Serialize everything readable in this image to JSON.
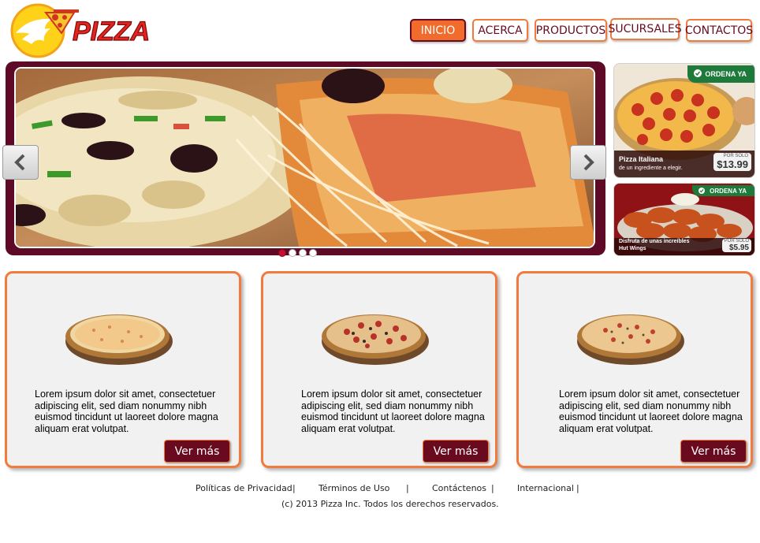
{
  "brand": {
    "logo_text": "PIZZA"
  },
  "nav": {
    "items": [
      {
        "label": "INICIO",
        "active": true
      },
      {
        "label": "ACERCA",
        "active": false
      },
      {
        "label": "PRODUCTOS",
        "active": false
      },
      {
        "label": "SUCURSALES",
        "active": false
      },
      {
        "label": "CONTACTOS",
        "active": false
      }
    ]
  },
  "slider": {
    "prev_icon": "chevron-left-icon",
    "next_icon": "chevron-right-icon",
    "dots": 4,
    "active_dot": 0
  },
  "promos": [
    {
      "badge": "ORDENA YA",
      "name": "Pizza Italiana",
      "subtitle": "de un ingrediente a elegir.",
      "price_prefix": "POR SOLO",
      "price": "$13.99"
    },
    {
      "badge": "ORDENA YA",
      "name": "Disfruta de unas increíbles",
      "subtitle": "Hut Wings",
      "price_prefix": "POR SOLO",
      "price": "$5.95"
    }
  ],
  "cards": [
    {
      "text": "Lorem ipsum dolor sit amet, consectetuer adipiscing elit, sed diam nonummy nibh euismod tincidunt ut laoreet dolore magna aliquam erat volutpat.",
      "button": "Ver más"
    },
    {
      "text": "Lorem ipsum dolor sit amet, consectetuer adipiscing elit, sed diam nonummy nibh euismod tincidunt ut laoreet dolore magna aliquam erat volutpat.",
      "button": "Ver más"
    },
    {
      "text": "Lorem ipsum dolor sit amet, consectetuer adipiscing elit, sed diam nonummy nibh euismod tincidunt ut laoreet dolore magna aliquam erat volutpat.",
      "button": "Ver más"
    }
  ],
  "footer": {
    "links": [
      "Políticas de Privacidad",
      "Términos de Uso",
      "Contáctenos",
      "Internacional"
    ],
    "separator": "|",
    "copyright": "(c) 2013 Pizza Inc. Todos los derechos reservados."
  },
  "colors": {
    "accent": "#f07b3c",
    "brand": "#6a0a1f",
    "active_nav": "#f06b2c",
    "slider_frame": "#5e0a26"
  }
}
